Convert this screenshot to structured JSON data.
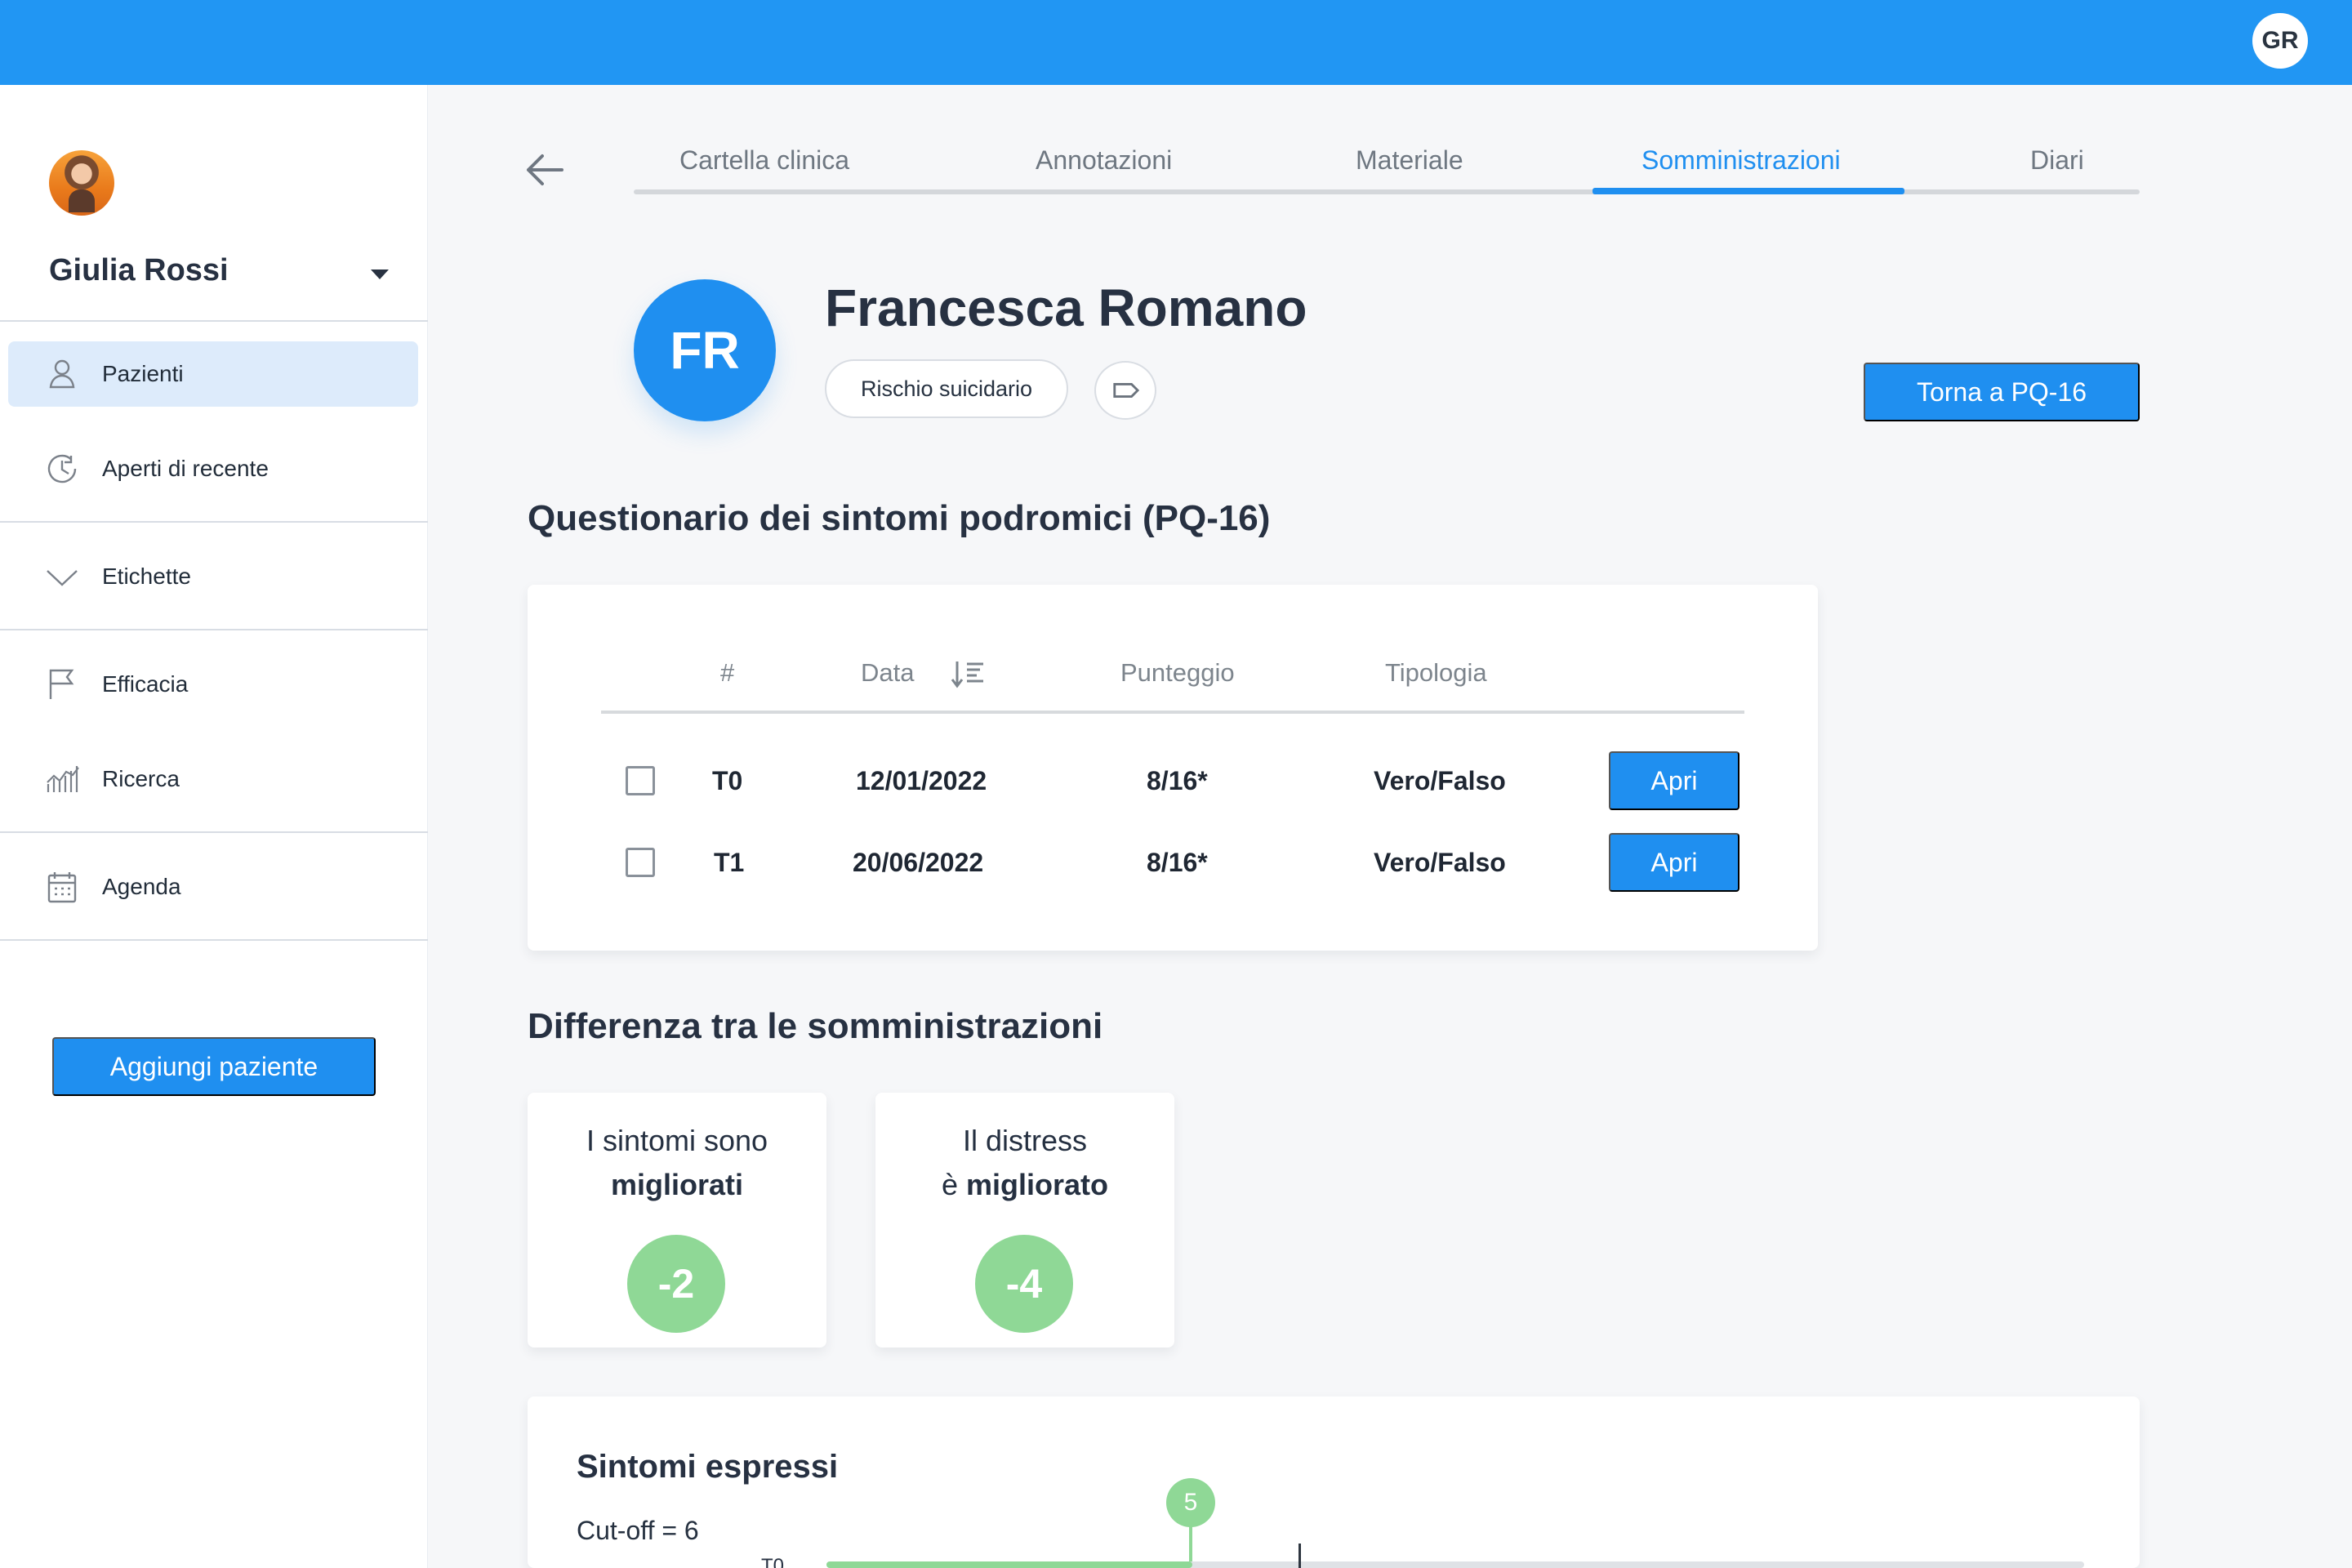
{
  "header": {
    "user_initials": "GR"
  },
  "sidebar": {
    "user_name": "Giulia Rossi",
    "items": [
      {
        "label": "Pazienti"
      },
      {
        "label": "Aperti di recente"
      },
      {
        "label": "Etichette"
      },
      {
        "label": "Efficacia"
      },
      {
        "label": "Ricerca"
      },
      {
        "label": "Agenda"
      }
    ],
    "add_patient": "Aggiungi paziente"
  },
  "tabs": [
    {
      "label": "Cartella clinica"
    },
    {
      "label": "Annotazioni"
    },
    {
      "label": "Materiale"
    },
    {
      "label": "Somministrazioni"
    },
    {
      "label": "Diari"
    }
  ],
  "patient": {
    "initials": "FR",
    "name": "Francesca Romano",
    "risk_badge": "Rischio suicidario",
    "return_button": "Torna a PQ-16"
  },
  "questionnaire": {
    "title": "Questionario dei sintomi podromici (PQ-16)",
    "columns": [
      "#",
      "Data",
      "Punteggio",
      "Tipologia"
    ],
    "rows": [
      {
        "id": "T0",
        "date": "12/01/2022",
        "score": "8/16*",
        "type": "Vero/Falso",
        "action": "Apri"
      },
      {
        "id": "T1",
        "date": "20/06/2022",
        "score": "8/16*",
        "type": "Vero/Falso",
        "action": "Apri"
      }
    ]
  },
  "differences": {
    "title": "Differenza tra le somministrazioni",
    "metrics": [
      {
        "line1": "I sintomi sono",
        "line2": "migliorati",
        "value": "-2"
      },
      {
        "line1": "Il distress",
        "line2_prefix": "è",
        "line2": "migliorato",
        "value": "-4"
      }
    ]
  },
  "symptoms": {
    "title": "Sintomi espressi",
    "cutoff": "Cut-off = 6",
    "marker_value": "5",
    "row_label": "T0"
  },
  "colors": {
    "primary": "#1f8ff0",
    "topbar": "#2196f3",
    "success": "#8fd896",
    "background": "#f6f7f9"
  }
}
